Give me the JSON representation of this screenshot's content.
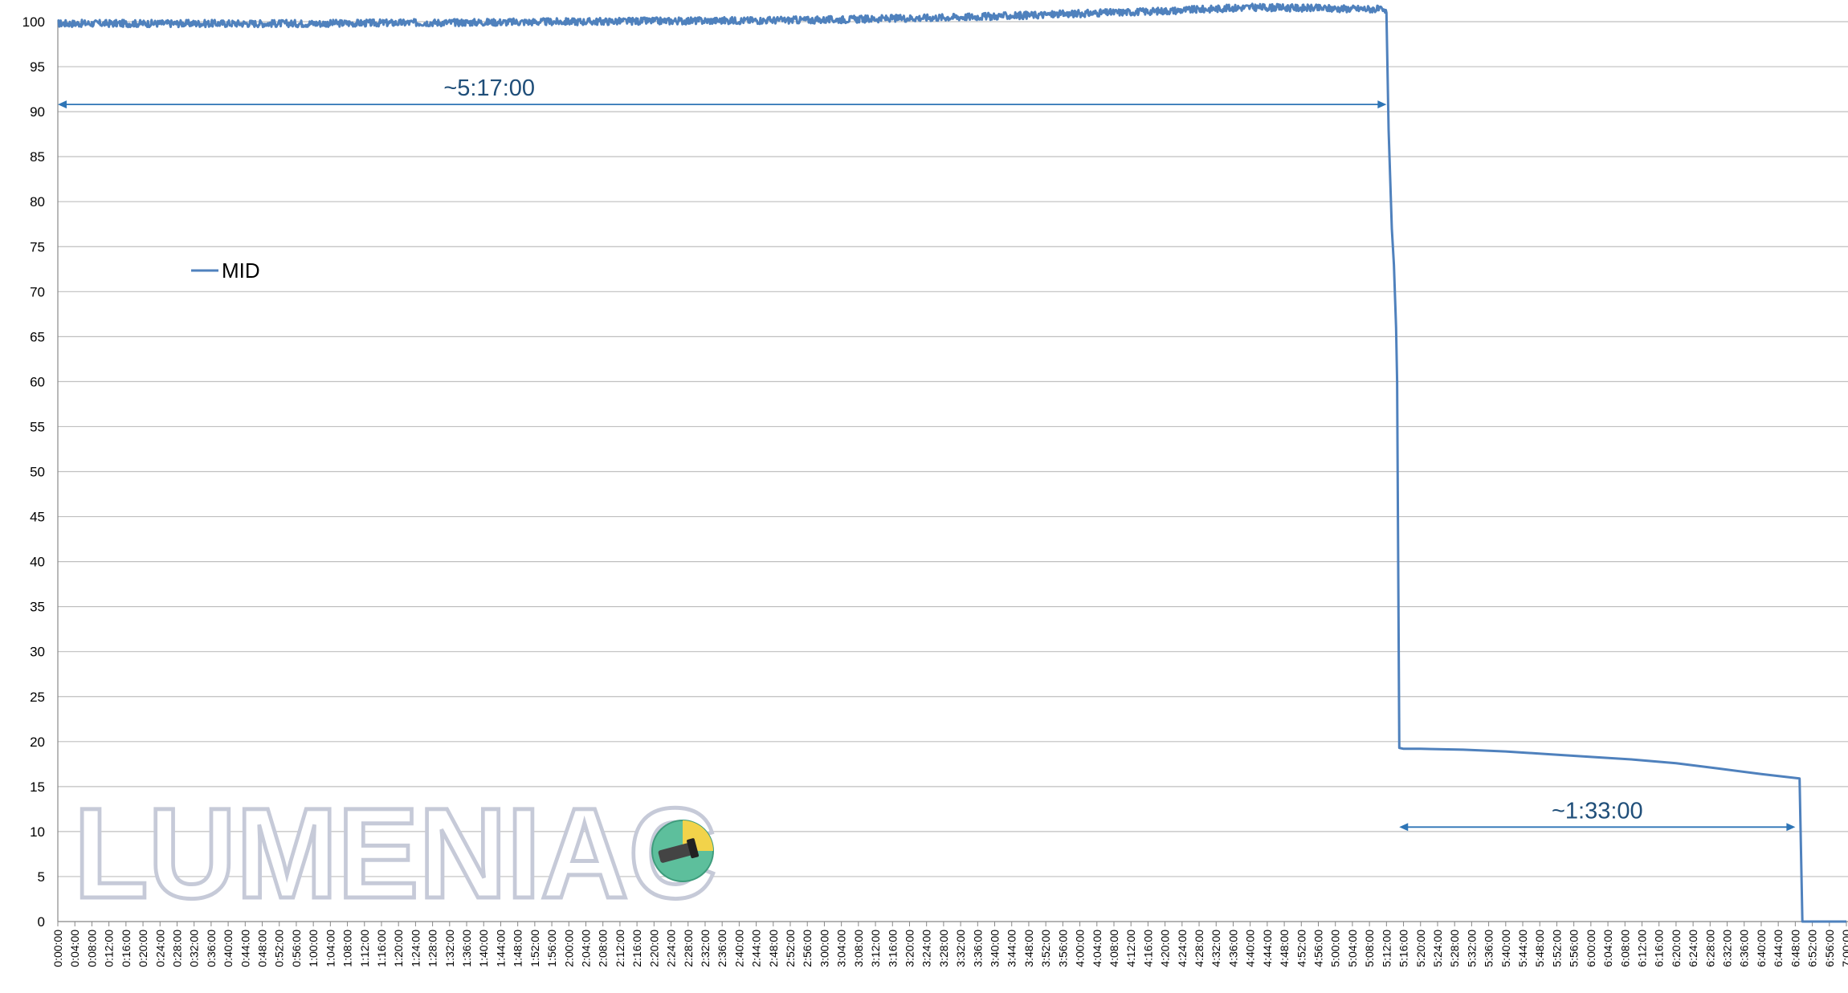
{
  "chart_data": {
    "type": "line",
    "title": "",
    "xlabel": "",
    "ylabel": "",
    "ylim": [
      0,
      100
    ],
    "yticks": [
      0,
      5,
      10,
      15,
      20,
      25,
      30,
      35,
      40,
      45,
      50,
      55,
      60,
      65,
      70,
      75,
      80,
      85,
      90,
      95,
      100
    ],
    "xlim": [
      "0:00:00",
      "7:00:00"
    ],
    "xtick_interval": "0:04:00",
    "grid": "horizontal",
    "legend": {
      "placement": "upper-left",
      "entries": [
        "MID"
      ]
    },
    "series": [
      {
        "name": "MID",
        "color": "#4f81bd",
        "x": [
          "0:00:00",
          "1:00:00",
          "2:00:00",
          "3:00:00",
          "3:40:00",
          "4:20:00",
          "4:40:00",
          "5:10:00",
          "5:12:00",
          "5:12:30",
          "5:13:15",
          "5:13:45",
          "5:14:15",
          "5:14:30",
          "5:15:00",
          "5:16:00",
          "5:20:00",
          "5:30:00",
          "5:40:00",
          "5:50:00",
          "6:00:00",
          "6:10:00",
          "6:20:00",
          "6:30:00",
          "6:40:00",
          "6:49:00",
          "6:49:40",
          "7:00:00"
        ],
        "y": [
          99.8,
          99.8,
          100.0,
          100.2,
          100.6,
          101.2,
          101.6,
          101.4,
          101.0,
          88.0,
          77.0,
          73.0,
          66.0,
          60.0,
          19.3,
          19.2,
          19.2,
          19.1,
          18.9,
          18.6,
          18.3,
          18.0,
          17.6,
          17.0,
          16.4,
          15.9,
          0.0,
          0.0
        ]
      }
    ],
    "annotations": [
      {
        "text": "~5:17:00",
        "from": "0:00:00",
        "to": "5:12:00",
        "y": 90.8
      },
      {
        "text": "~1:33:00",
        "from": "5:15:00",
        "to": "6:48:00",
        "y": 10.5
      }
    ]
  },
  "watermark": {
    "text": "LUMENIAC",
    "icon": "flashlight-logo-icon"
  }
}
